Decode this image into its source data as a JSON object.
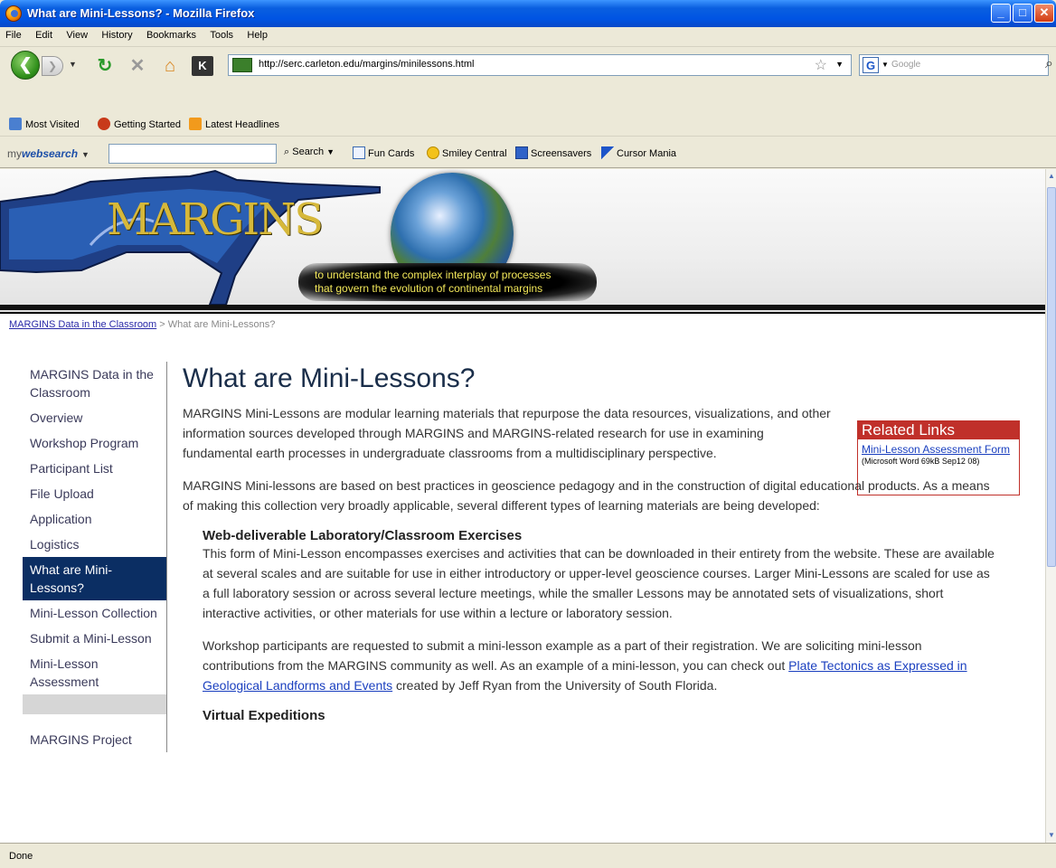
{
  "window": {
    "title": "What are Mini-Lessons? - Mozilla Firefox"
  },
  "menu": [
    "File",
    "Edit",
    "View",
    "History",
    "Bookmarks",
    "Tools",
    "Help"
  ],
  "nav": {
    "url": "http://serc.carleton.edu/margins/minilessons.html",
    "search_placeholder": "Google"
  },
  "bookmarks": [
    "Most Visited",
    "Getting Started",
    "Latest Headlines"
  ],
  "toolbar": {
    "brand_prefix": "my",
    "brand_name": "websearch",
    "search_label": "Search",
    "items": [
      "Fun Cards",
      "Smiley Central",
      "Screensavers",
      "Cursor Mania"
    ]
  },
  "banner": {
    "logo": "MARGINS",
    "tagline_1": "to understand the complex interplay of processes",
    "tagline_2": "that govern the evolution of continental margins"
  },
  "breadcrumb": {
    "link": "MARGINS Data in the Classroom",
    "sep": ">",
    "current": "What are Mini-Lessons?"
  },
  "sidebar": {
    "items": [
      "MARGINS Data in the Classroom",
      "Overview",
      "Workshop Program",
      "Participant List",
      "File Upload",
      "Application",
      "Logistics",
      "What are Mini-Lessons?",
      "Mini-Lesson Collection",
      "Submit a Mini-Lesson",
      "Mini-Lesson Assessment",
      "MARGINS Project"
    ]
  },
  "related": {
    "title": "Related Links",
    "link": "Mini-Lesson Assessment Form",
    "meta": "(Microsoft Word 69kB Sep12 08)"
  },
  "main": {
    "title": "What are Mini-Lessons?",
    "p1": "MARGINS Mini-Lessons are modular learning materials that repurpose the data resources, visualizations, and other information sources developed through MARGINS and MARGINS-related research for use in examining fundamental earth processes in undergraduate classrooms from a multidisciplinary perspective.",
    "p2": "MARGINS Mini-lessons are based on best practices in geoscience pedagogy and in the construction of digital educational products. As a means of making this collection very broadly applicable, several different types of learning materials are being developed:",
    "h1": "Web-deliverable Laboratory/Classroom Exercises",
    "p3": "This form of Mini-Lesson encompasses exercises and activities that can be downloaded in their entirety from the website. These are available at several scales and are suitable for use in either introductory or upper-level geoscience courses. Larger Mini-Lessons are scaled for use as a full laboratory session or across several lecture meetings, while the smaller Lessons may be annotated sets of visualizations, short interactive activities, or other materials for use within a lecture or laboratory session.",
    "p4_pre": "Workshop participants are requested to submit a mini-lesson example as a part of their registration. We are soliciting mini-lesson contributions from the MARGINS community as well. As an example of a mini-lesson, you can check out ",
    "p4_link": "Plate Tectonics as Expressed in Geological Landforms and Events",
    "p4_post": " created by Jeff Ryan from the University of South Florida.",
    "h2": "Virtual Expeditions"
  },
  "status": "Done"
}
